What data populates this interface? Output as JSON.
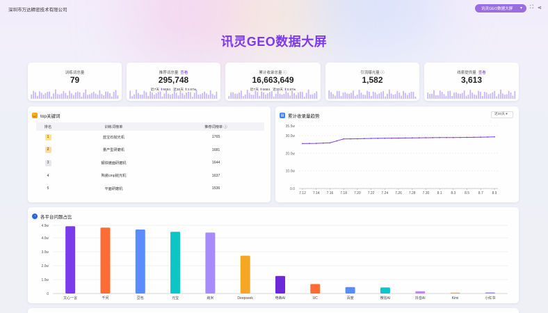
{
  "header": {
    "company": "深圳市万达精密技术有限公司",
    "screen_select": "讯灵GEO数据大屏",
    "title": "讯灵GEO数据大屏"
  },
  "stats": [
    {
      "label": "训练词总量",
      "value": "79",
      "tag": "",
      "sub": null
    },
    {
      "label": "推荐词总量",
      "value": "295,748",
      "tag": "查看",
      "sub": {
        "l1": "近7天",
        "v1": "6684",
        "l2": "近30天",
        "v2": "3.87w"
      }
    },
    {
      "label": "累计收录总量",
      "value": "16,663,649",
      "tag": "",
      "sub": {
        "l1": "近7天",
        "v1": "6684",
        "l2": "近30天",
        "v2": "3.87w"
      }
    },
    {
      "label": "引流曝光量",
      "value": "1,582",
      "tag": "",
      "sub": null
    },
    {
      "label": "线索提供量",
      "value": "3,613",
      "tag": "查看",
      "sub": null
    }
  ],
  "keywords": {
    "title": "top关键词",
    "headers": [
      "排名",
      "训练词榜单",
      "推荐词榜单"
    ],
    "rows": [
      {
        "rank": "1",
        "name": "蓝宝石抛光机",
        "count": "1765"
      },
      {
        "rank": "2",
        "name": "量产型研磨机",
        "count": "1681"
      },
      {
        "rank": "3",
        "name": "钢铁镀面研磨机",
        "count": "1644"
      },
      {
        "rank": "4",
        "name": "陶瓷cmp抛光机",
        "count": "1637"
      },
      {
        "rank": "5",
        "name": "平面研磨机",
        "count": "1536"
      }
    ]
  },
  "trend": {
    "title": "累计收录量趋势",
    "range": "近30天"
  },
  "platform": {
    "title": "各平台问题占比"
  },
  "chart_data": [
    {
      "type": "line",
      "title": "累计收录量趋势",
      "x": [
        "7.12",
        "7.14",
        "7.16",
        "7.18",
        "7.20",
        "7.22",
        "7.24",
        "7.26",
        "7.28",
        "7.30",
        "8.1",
        "8.3",
        "8.5",
        "8.7",
        "8.9"
      ],
      "y_ticks": [
        "0.0",
        "10.0w",
        "20.0w",
        "30.0w",
        "35.5w"
      ],
      "ylim": [
        0,
        35.5
      ],
      "series": [
        {
          "values": [
            25.5,
            25.6,
            25.9,
            28.1,
            28.2,
            28.4,
            28.5,
            28.6,
            28.7,
            28.8,
            28.9,
            28.9,
            29.0,
            29.1,
            29.3
          ]
        }
      ],
      "color": "#7c3aed"
    },
    {
      "type": "bar",
      "title": "各平台问题占比",
      "categories": [
        "文心一言",
        "千问",
        "豆包",
        "元宝",
        "纳米",
        "Deepseek",
        "电犇AI",
        "UC",
        "百度",
        "微信AI",
        "抖音AI",
        "Kimi",
        "小红书"
      ],
      "values": [
        4.84,
        4.74,
        4.6,
        4.44,
        4.38,
        2.72,
        1.26,
        0.68,
        0.46,
        0.44,
        0.16,
        0.06,
        0.08
      ],
      "y_ticks": [
        "0",
        "1.0w",
        "2.0w",
        "3.0w",
        "4.0w",
        "4.9w"
      ],
      "ylim": [
        0,
        4.9
      ],
      "colors": [
        "#7c3aed",
        "#ff6b35",
        "#5b8cff",
        "#0ec5c5",
        "#a78bfa",
        "#f5a623",
        "#6d28d9",
        "#ff6b35",
        "#5b8cff",
        "#0ec5c5",
        "#c084fc",
        "#f5a623",
        "#a78bfa"
      ]
    }
  ],
  "spark_color": "#c4b5fd"
}
